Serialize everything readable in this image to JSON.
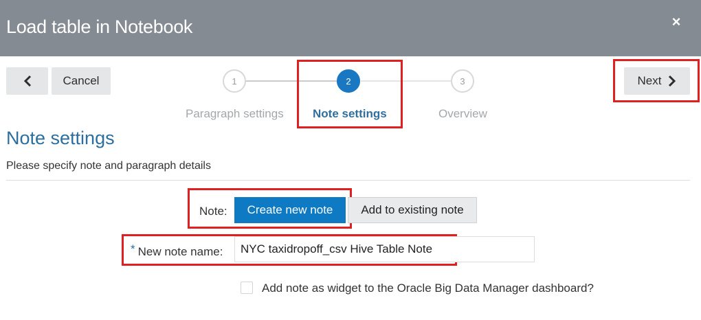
{
  "window": {
    "title": "Load table in Notebook",
    "close_label": "×"
  },
  "toolbar": {
    "back_icon": "chevron-left-icon",
    "cancel_label": "Cancel",
    "next_label": "Next",
    "next_icon": "chevron-right-icon"
  },
  "wizard": {
    "steps": [
      {
        "number": "1",
        "label": "Paragraph settings",
        "state": "inactive"
      },
      {
        "number": "2",
        "label": "Note settings",
        "state": "active"
      },
      {
        "number": "3",
        "label": "Overview",
        "state": "inactive"
      }
    ]
  },
  "section": {
    "title": "Note settings",
    "subtitle": "Please specify note and paragraph details"
  },
  "form": {
    "note_label": "Note:",
    "note_options": [
      {
        "label": "Create new note",
        "selected": true
      },
      {
        "label": "Add to existing note",
        "selected": false
      }
    ],
    "required_marker": "*",
    "name_label": "New note name:",
    "name_value": "NYC taxidropoff_csv Hive Table Note",
    "widget_checkbox_label": "Add note as widget to the Oracle Big Data Manager dashboard?",
    "widget_checkbox_checked": false
  },
  "colors": {
    "titlebar": "#858b93",
    "accent": "#0d7ac3",
    "highlight_box": "#e02020"
  }
}
